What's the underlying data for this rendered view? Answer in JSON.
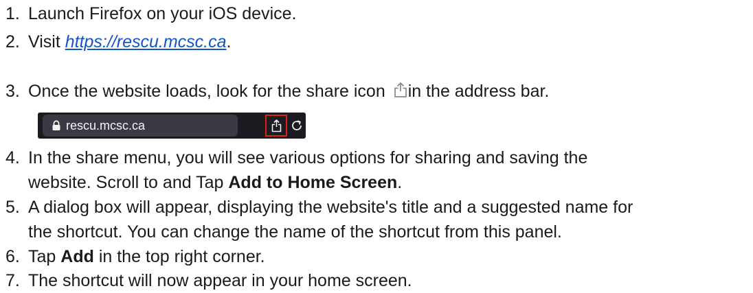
{
  "steps": [
    {
      "num": "1.",
      "text": "Launch Firefox on your iOS device."
    },
    {
      "num": "2.",
      "prefix": "Visit ",
      "link": "https://rescu.mcsc.ca",
      "suffix": "."
    },
    {
      "num": "3.",
      "before_icon": "Once the website loads, look for the share icon ",
      "after_icon": "in the address bar.",
      "icon": "share-icon"
    },
    {
      "num": "4.",
      "line1": "In the share menu, you will see various options for sharing and saving the",
      "line2_prefix": "website. Scroll to and Tap ",
      "line2_bold": "Add to Home Screen",
      "line2_suffix": "."
    },
    {
      "num": "5.",
      "line1": "A dialog box will appear, displaying the website's title and a suggested name for",
      "line2": "the shortcut. You can change the name of the shortcut from this panel."
    },
    {
      "num": "6.",
      "prefix": "Tap ",
      "bold": "Add",
      "suffix": " in the top right corner."
    },
    {
      "num": "7.",
      "text": "The shortcut will now appear in your home screen."
    }
  ],
  "address_bar": {
    "url": "rescu.mcsc.ca",
    "lock_icon": "lock-icon",
    "share_icon": "share-icon",
    "reload_icon": "reload-icon",
    "highlight_color": "#e0201a",
    "bar_color": "#1c1b22",
    "field_color": "#3a3944"
  },
  "colors": {
    "link": "#1155cc",
    "text": "#1a1a1a"
  }
}
